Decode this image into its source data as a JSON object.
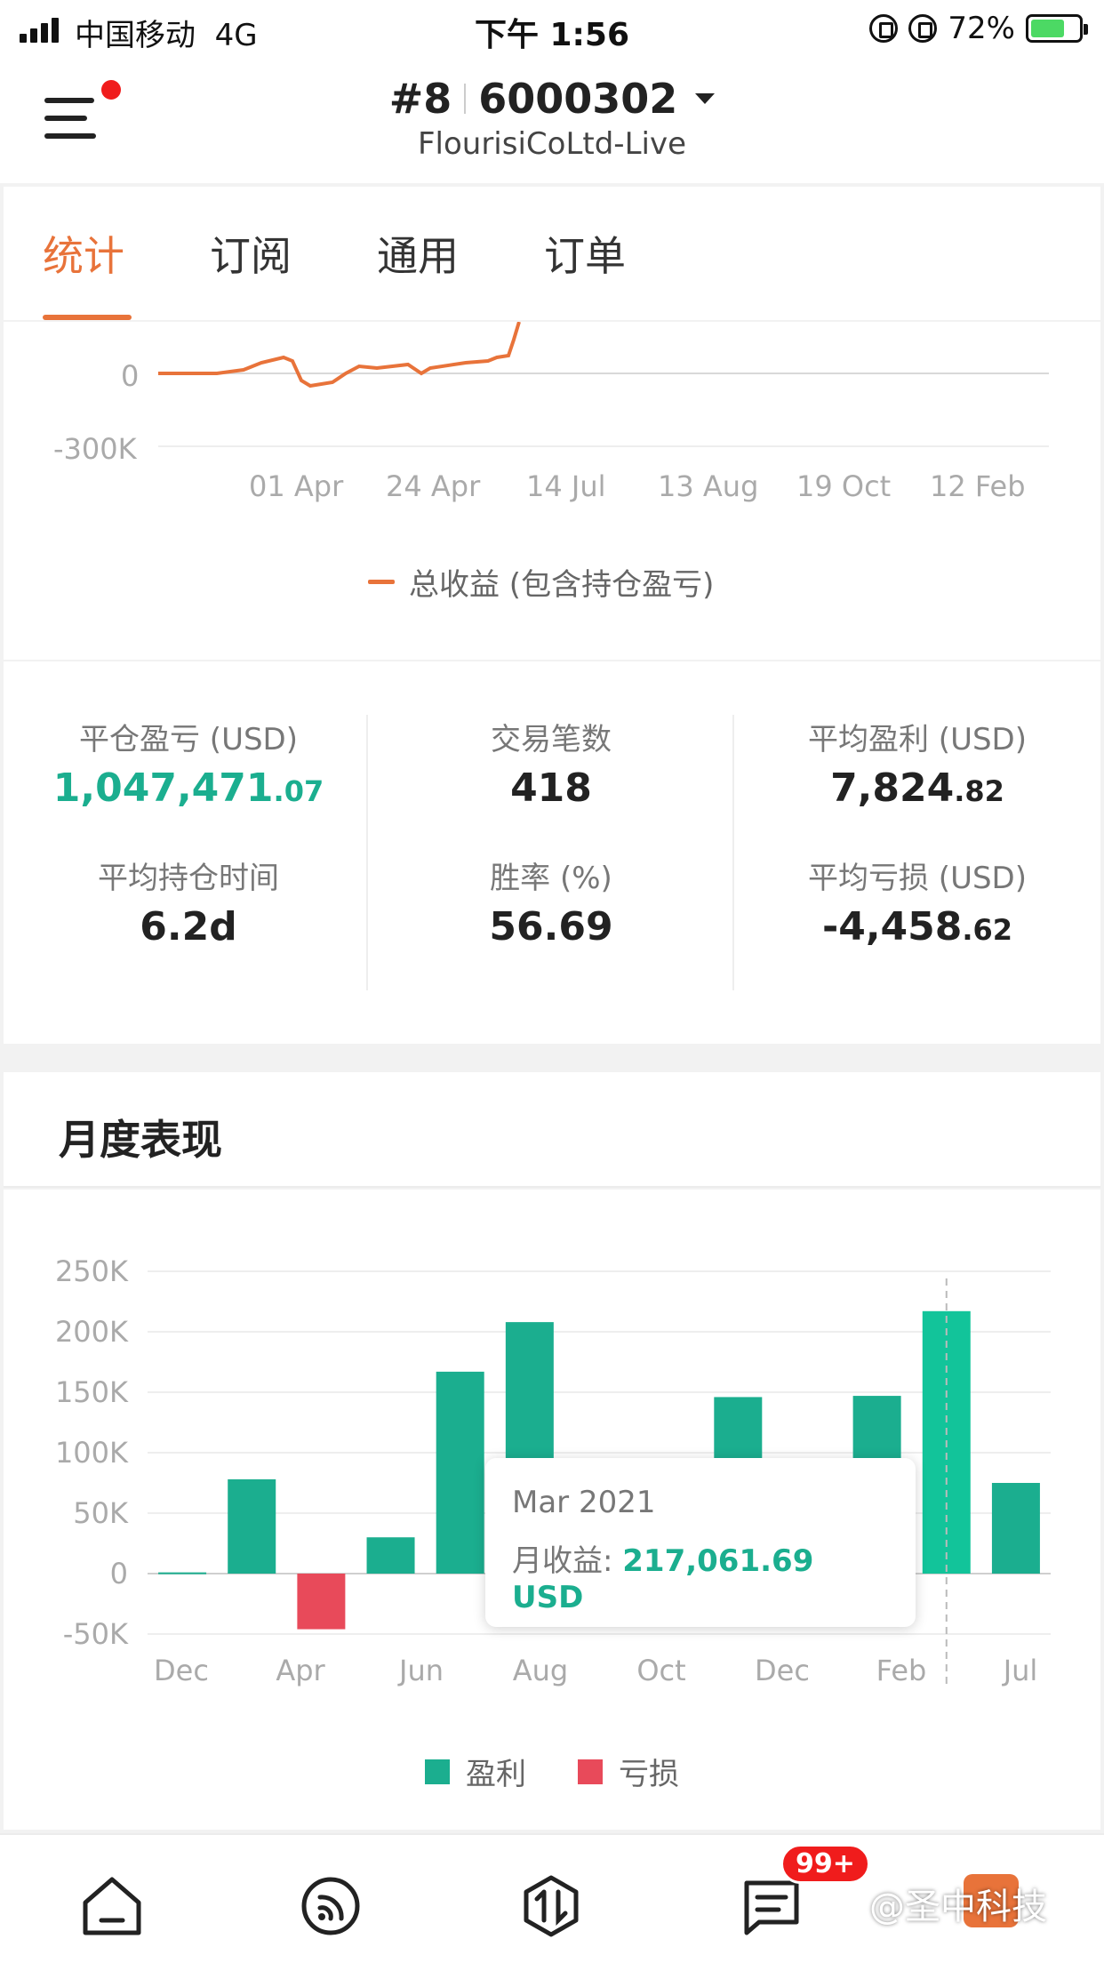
{
  "status_bar": {
    "carrier": "中国移动",
    "network": "4G",
    "time": "下午 1:56",
    "battery": "72%"
  },
  "header": {
    "account_index": "#8",
    "account_number": "6000302",
    "broker": "FlourisiCoLtd-Live"
  },
  "tabs": [
    {
      "label": "统计",
      "active": true
    },
    {
      "label": "订阅",
      "active": false
    },
    {
      "label": "通用",
      "active": false
    },
    {
      "label": "订单",
      "active": false
    }
  ],
  "line_chart": {
    "y_ticks": [
      "0",
      "-300K"
    ],
    "x_ticks": [
      "01 Apr",
      "24 Apr",
      "14 Jul",
      "13 Aug",
      "19 Oct",
      "12 Feb"
    ],
    "legend": "总收益 (包含持仓盈亏)",
    "color": "#e8733a"
  },
  "stats": {
    "closed_pnl": {
      "label": "平仓盈亏 (USD)",
      "int": "1,047,471",
      "dec": ".07"
    },
    "trade_count": {
      "label": "交易笔数",
      "value": "418"
    },
    "avg_profit": {
      "label": "平均盈利 (USD)",
      "int": "7,824",
      "dec": ".82"
    },
    "avg_hold": {
      "label": "平均持仓时间",
      "value": "6.2d"
    },
    "win_rate": {
      "label": "胜率 (%)",
      "value": "56.69"
    },
    "avg_loss": {
      "label": "平均亏损 (USD)",
      "int": "-4,458",
      "dec": ".62"
    }
  },
  "monthly": {
    "title": "月度表现",
    "tooltip_title": "Mar 2021",
    "tooltip_label": "月收益: ",
    "tooltip_value": "217,061.69 USD",
    "legend_profit": "盈利",
    "legend_loss": "亏损"
  },
  "chart_data": {
    "type": "bar",
    "y_ticks": [
      "250K",
      "200K",
      "150K",
      "100K",
      "50K",
      "0",
      "-50K"
    ],
    "x_ticks": [
      "Dec",
      "Apr",
      "Jun",
      "Aug",
      "Oct",
      "Dec",
      "Feb",
      "Jul"
    ],
    "ylim": [
      -50000,
      250000
    ],
    "values": [
      1000,
      78000,
      -46000,
      30000,
      167000,
      208000,
      0,
      0,
      146000,
      0,
      147000,
      217061.69,
      75000
    ],
    "profit_color": "#1bae8f",
    "loss_color": "#e84a5a",
    "highlight_index": 11
  },
  "bottom_nav": {
    "badge": "99+",
    "watermark": "@圣中科技"
  }
}
